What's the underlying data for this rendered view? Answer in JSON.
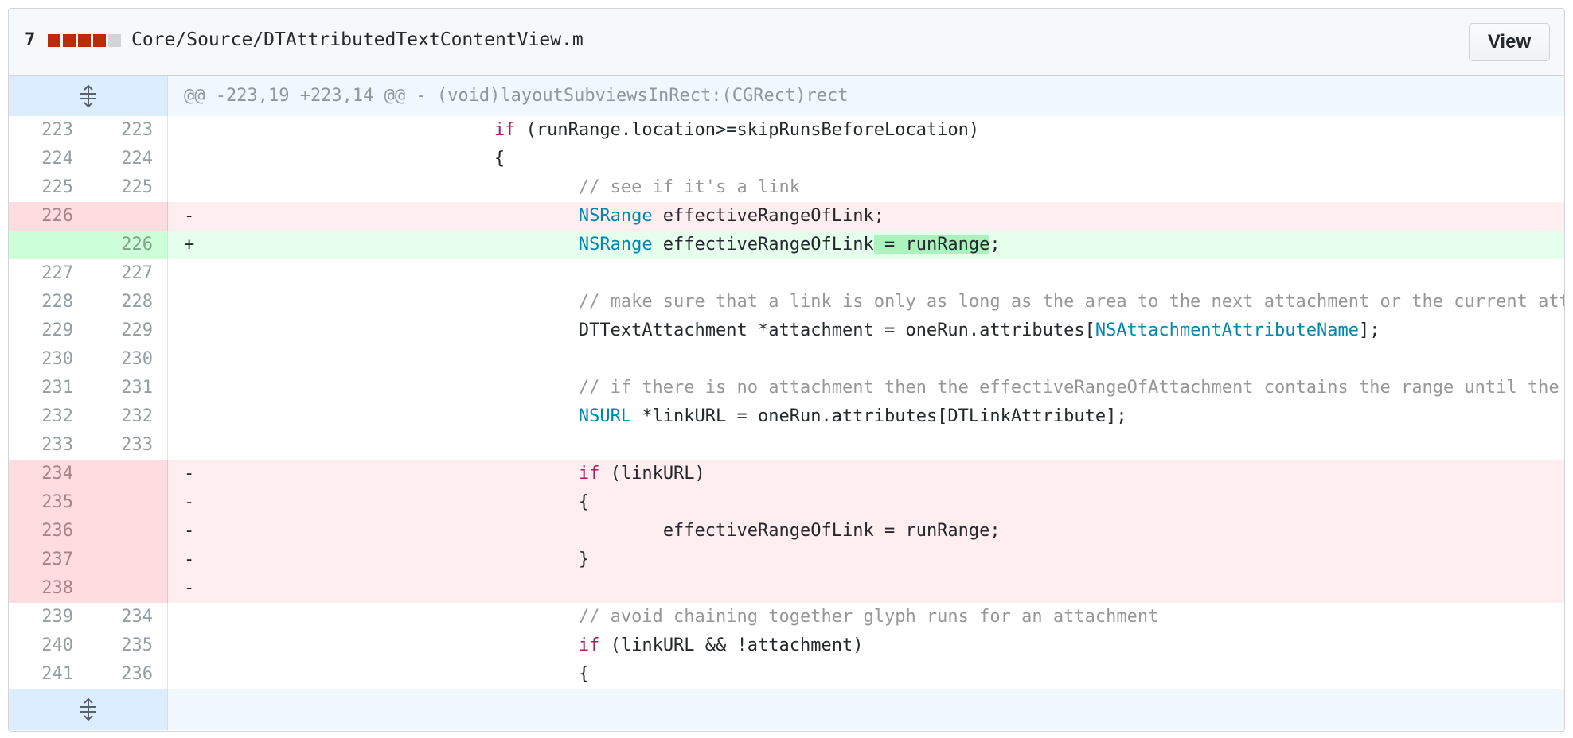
{
  "file": {
    "changes": "7",
    "diffstat": [
      "#bd2c00",
      "#bd2c00",
      "#bd2c00",
      "#bd2c00",
      "#d1d5da"
    ],
    "path": "Core/Source/DTAttributedTextContentView.m",
    "view_label": "View"
  },
  "hunk": {
    "header": "@@ -223,19 +223,14 @@ - (void)layoutSubviewsInRect:(CGRect)rect",
    "expand_icon": "unfold-icon"
  },
  "colors": {
    "deletion_bg": "#ffeef0",
    "addition_bg": "#e6ffed",
    "keyword": "#a71d5d",
    "type": "#0086b3",
    "comment": "#969896"
  },
  "lines": [
    {
      "type": "ctx",
      "old": "223",
      "new": "223",
      "sign": "",
      "indent": "                        ",
      "tokens": [
        {
          "k": "kw",
          "t": "if"
        },
        {
          "k": "",
          "t": " (runRange.location>=skipRunsBeforeLocation)"
        }
      ]
    },
    {
      "type": "ctx",
      "old": "224",
      "new": "224",
      "sign": "",
      "indent": "                        ",
      "tokens": [
        {
          "k": "",
          "t": "{"
        }
      ]
    },
    {
      "type": "ctx",
      "old": "225",
      "new": "225",
      "sign": "",
      "indent": "                                ",
      "tokens": [
        {
          "k": "cm",
          "t": "// see if it's a link"
        }
      ]
    },
    {
      "type": "del",
      "old": "226",
      "new": "",
      "sign": "-",
      "indent": "                                ",
      "tokens": [
        {
          "k": "ty",
          "t": "NSRange"
        },
        {
          "k": "",
          "t": " effectiveRangeOfLink;"
        }
      ]
    },
    {
      "type": "add",
      "old": "",
      "new": "226",
      "sign": "+",
      "indent": "                                ",
      "tokens": [
        {
          "k": "ty",
          "t": "NSRange"
        },
        {
          "k": "",
          "t": " effectiveRangeOfLink"
        },
        {
          "k": "hl",
          "t": " = runRange"
        },
        {
          "k": "",
          "t": ";"
        }
      ]
    },
    {
      "type": "ctx",
      "old": "227",
      "new": "227",
      "sign": "",
      "indent": "",
      "tokens": []
    },
    {
      "type": "ctx",
      "old": "228",
      "new": "228",
      "sign": "",
      "indent": "                                ",
      "tokens": [
        {
          "k": "cm",
          "t": "// make sure that a link is only as long as the area to the next attachment or the current attachment itself"
        }
      ]
    },
    {
      "type": "ctx",
      "old": "229",
      "new": "229",
      "sign": "",
      "indent": "                                ",
      "tokens": [
        {
          "k": "",
          "t": "DTTextAttachment *attachment = oneRun.attributes["
        },
        {
          "k": "ty",
          "t": "NSAttachmentAttributeName"
        },
        {
          "k": "",
          "t": "];"
        }
      ]
    },
    {
      "type": "ctx",
      "old": "230",
      "new": "230",
      "sign": "",
      "indent": "",
      "tokens": []
    },
    {
      "type": "ctx",
      "old": "231",
      "new": "231",
      "sign": "",
      "indent": "                                ",
      "tokens": [
        {
          "k": "cm",
          "t": "// if there is no attachment then the effectiveRangeOfAttachment contains the range until the next attachment"
        }
      ]
    },
    {
      "type": "ctx",
      "old": "232",
      "new": "232",
      "sign": "",
      "indent": "                                ",
      "tokens": [
        {
          "k": "ty",
          "t": "NSURL"
        },
        {
          "k": "",
          "t": " *linkURL = oneRun.attributes[DTLinkAttribute];"
        }
      ]
    },
    {
      "type": "ctx",
      "old": "233",
      "new": "233",
      "sign": "",
      "indent": "",
      "tokens": []
    },
    {
      "type": "del",
      "old": "234",
      "new": "",
      "sign": "-",
      "indent": "                                ",
      "tokens": [
        {
          "k": "kw",
          "t": "if"
        },
        {
          "k": "",
          "t": " (linkURL)"
        }
      ]
    },
    {
      "type": "del",
      "old": "235",
      "new": "",
      "sign": "-",
      "indent": "                                ",
      "tokens": [
        {
          "k": "",
          "t": "{"
        }
      ]
    },
    {
      "type": "del",
      "old": "236",
      "new": "",
      "sign": "-",
      "indent": "                                        ",
      "tokens": [
        {
          "k": "",
          "t": "effectiveRangeOfLink = runRange;"
        }
      ]
    },
    {
      "type": "del",
      "old": "237",
      "new": "",
      "sign": "-",
      "indent": "                                ",
      "tokens": [
        {
          "k": "",
          "t": "}"
        }
      ]
    },
    {
      "type": "del",
      "old": "238",
      "new": "",
      "sign": "-",
      "indent": "",
      "tokens": []
    },
    {
      "type": "ctx",
      "old": "239",
      "new": "234",
      "sign": "",
      "indent": "                                ",
      "tokens": [
        {
          "k": "cm",
          "t": "// avoid chaining together glyph runs for an attachment"
        }
      ]
    },
    {
      "type": "ctx",
      "old": "240",
      "new": "235",
      "sign": "",
      "indent": "                                ",
      "tokens": [
        {
          "k": "kw",
          "t": "if"
        },
        {
          "k": "",
          "t": " (linkURL && !attachment)"
        }
      ]
    },
    {
      "type": "ctx",
      "old": "241",
      "new": "236",
      "sign": "",
      "indent": "                                ",
      "tokens": [
        {
          "k": "",
          "t": "{"
        }
      ]
    }
  ]
}
